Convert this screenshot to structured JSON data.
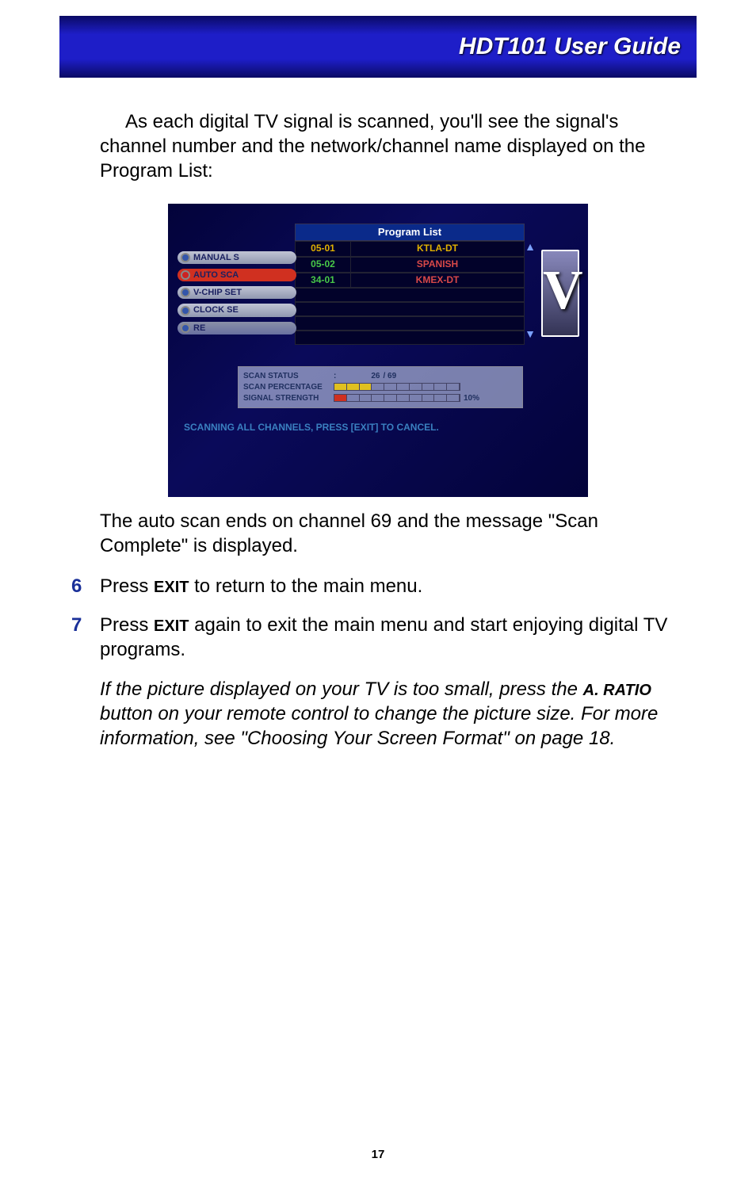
{
  "header": {
    "title": "HDT101 User Guide"
  },
  "intro": "As each digital TV signal is scanned, you'll see the signal's channel number and the network/channel name displayed on the Program List:",
  "screenshot": {
    "program_list_header": "Program List",
    "rows": [
      {
        "ch": "05-01",
        "name": "KTLA-DT"
      },
      {
        "ch": "05-02",
        "name": "SPANISH"
      },
      {
        "ch": "34-01",
        "name": "KMEX-DT"
      }
    ],
    "sidemenu": [
      "MANUAL S",
      "AUTO SCA",
      "V-CHIP SET",
      "CLOCK SE",
      "RE"
    ],
    "scan_status_label": "SCAN STATUS",
    "scan_status_sep": ":",
    "scan_status_current": "26",
    "scan_status_total": "/ 69",
    "scan_pct_label": "SCAN PERCENTAGE",
    "signal_strength_label": "SIGNAL STRENGTH",
    "signal_pct": "10%",
    "scan_note": "SCANNING ALL CHANNELS, PRESS [EXIT] TO CANCEL."
  },
  "caption": "The auto scan ends on channel 69 and the message \"Scan Complete\" is displayed.",
  "steps": {
    "six_num": "6",
    "six_a": "Press ",
    "six_key": "EXIT",
    "six_b": " to return to the main menu.",
    "seven_num": "7",
    "seven_a": "Press ",
    "seven_key": "EXIT",
    "seven_b": " again to exit the main menu and start enjoying digital TV programs."
  },
  "note": {
    "a": "If the picture displayed on your TV is too small, press the ",
    "key": "A. RATIO",
    "b": " button on your remote control to change the picture size. For more information, see \"Choosing Your Screen Format\" on page 18."
  },
  "page_number": "17"
}
